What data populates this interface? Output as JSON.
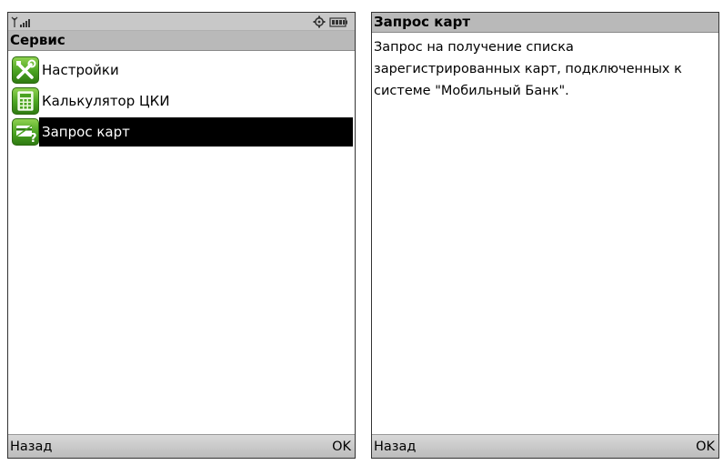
{
  "left_screen": {
    "status_bar": {
      "signal_icon": "antenna-signal-icon",
      "settings_icon": "gear-icon",
      "battery_icon": "battery-icon"
    },
    "title": "Сервис",
    "menu_items": [
      {
        "label": "Настройки",
        "icon": "tools-icon",
        "selected": false
      },
      {
        "label": "Калькулятор ЦКИ",
        "icon": "calculator-icon",
        "selected": false
      },
      {
        "label": "Запрос карт",
        "icon": "card-query-icon",
        "selected": true
      }
    ],
    "softkeys": {
      "left": "Назад",
      "right": "OK"
    }
  },
  "right_screen": {
    "title": "Запрос карт",
    "description_lines": [
      "Запрос на получение списка",
      "зарегистрированных карт, подключенных к",
      "системе \"Мобильный Банк\"."
    ],
    "softkeys": {
      "left": "Назад",
      "right": "OK"
    }
  },
  "colors": {
    "selection_bg": "#000000",
    "title_bar_bg": "#b9b9b9",
    "icon_green": "#4aa321"
  }
}
